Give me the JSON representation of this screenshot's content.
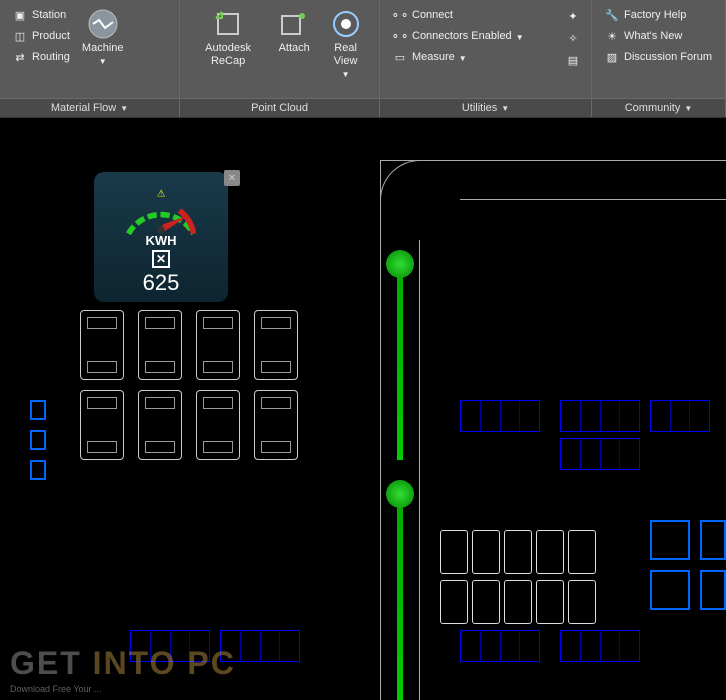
{
  "ribbon": {
    "materialFlow": {
      "title": "Material Flow",
      "station": "Station",
      "product": "Product",
      "routing": "Routing",
      "machine": "Machine"
    },
    "pointCloud": {
      "title": "Point Cloud",
      "recap": "Autodesk ReCap",
      "attach": "Attach",
      "realView": "Real View"
    },
    "utilities": {
      "title": "Utilities",
      "connect": "Connect",
      "connectorsEnabled": "Connectors Enabled",
      "measure": "Measure"
    },
    "community": {
      "title": "Community",
      "factoryHelp": "Factory Help",
      "whatsNew": "What's New",
      "discussionForum": "Discussion Forum"
    }
  },
  "gauge": {
    "unit": "KWH",
    "value": "625"
  },
  "watermark": {
    "part1": "GET ",
    "part2": "INTO PC",
    "sub": "Download Free Your ..."
  }
}
